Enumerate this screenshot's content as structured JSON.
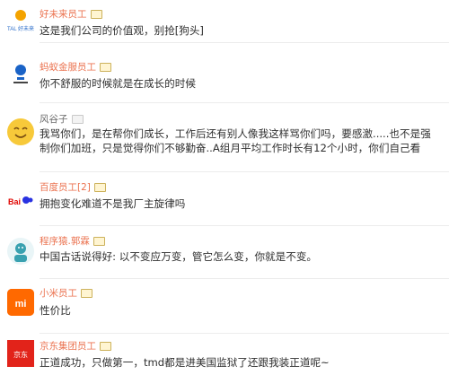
{
  "comments": [
    {
      "user": "好未来员工",
      "text": "这是我们公司的价值观，别抢[狗头]",
      "name_color": "#eb7350",
      "avatar": {
        "icon": "tal-logo-icon",
        "label": "TAL 好未来",
        "bg": "#ffffff",
        "fg": "#2a6cc9"
      }
    },
    {
      "user": "蚂蚁金服员工",
      "text": "你不舒服的时候就是在成长的时候",
      "name_color": "#eb7350",
      "avatar": {
        "icon": "ant-financial-logo-icon",
        "label": "",
        "bg": "#ffffff",
        "fg": "#1a63c7"
      }
    },
    {
      "user": "风谷子",
      "text": "我骂你们，是在帮你们成长，工作后还有别人像我这样骂你们吗，要感激.....也不是强制你们加班，只是觉得你们不够勤奋..A组月平均工作时长有12个小时，你们自己看",
      "name_color": "#6a6a6a",
      "avatar": {
        "icon": "smiley-face-icon",
        "label": "",
        "bg": "#f7c93a",
        "fg": "#7a4f12"
      }
    },
    {
      "user": "百度员工[2]",
      "text": "拥抱变化难道不是我厂主旋律吗",
      "name_color": "#eb7350",
      "avatar": {
        "icon": "baidu-logo-icon",
        "label": "Bai",
        "bg": "#ffffff",
        "fg": "#2932e1"
      }
    },
    {
      "user": "程序猿.郭霖",
      "text": "中国古话说得好: 以不变应万变，管它怎么变，你就是不变。",
      "name_color": "#eb7350",
      "avatar": {
        "icon": "cartoon-avatar-icon",
        "label": "",
        "bg": "#e9f5f7",
        "fg": "#39a1b0"
      }
    },
    {
      "user": "小米员工",
      "text": "性价比",
      "name_color": "#eb7350",
      "avatar": {
        "icon": "mi-logo-icon",
        "label": "mi",
        "bg": "#ff6900",
        "fg": "#ffffff"
      }
    },
    {
      "user": "京东集团员工",
      "text": "正道成功，只做第一，tmd都是进美国监狱了还跟我装正道呢~",
      "name_color": "#eb7350",
      "avatar": {
        "icon": "jd-logo-icon",
        "label": "京东",
        "bg": "#e2231a",
        "fg": "#ffffff"
      }
    }
  ]
}
